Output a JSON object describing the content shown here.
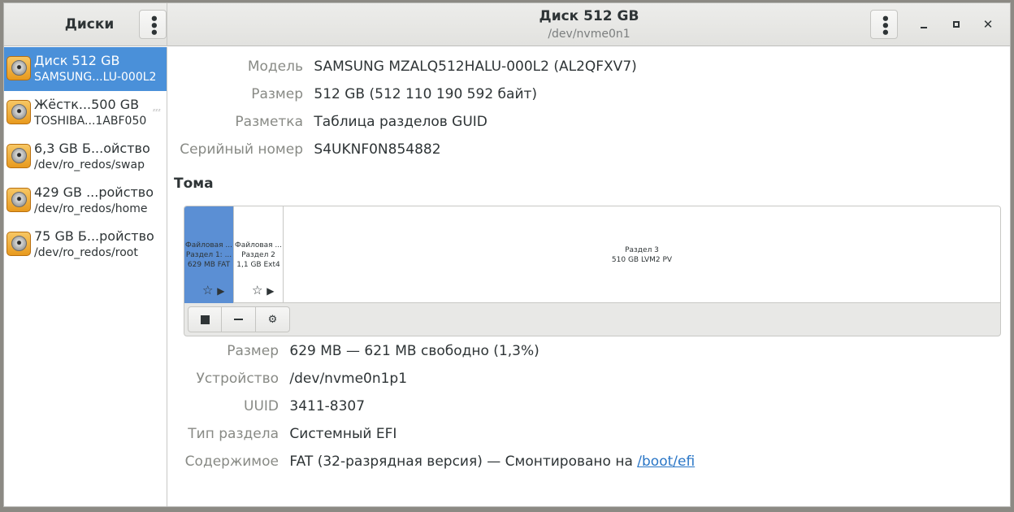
{
  "app": {
    "title": "Диски"
  },
  "header": {
    "title": "Диск 512 GB",
    "subtitle": "/dev/nvme0n1"
  },
  "sidebar": {
    "items": [
      {
        "name": "Диск 512 GB",
        "sub": "SAMSUNG...LU-000L2",
        "selected": true
      },
      {
        "name": "Жёстк...500 GB",
        "sub": "TOSHIBA...1ABF050",
        "sleeping": true
      },
      {
        "name": "6,3 GB Б...ойство",
        "sub": "/dev/ro_redos/swap"
      },
      {
        "name": "429 GB ...ройство",
        "sub": "/dev/ro_redos/home"
      },
      {
        "name": "75 GB Б...ройство",
        "sub": "/dev/ro_redos/root"
      }
    ]
  },
  "disk": {
    "model_label": "Модель",
    "model": "SAMSUNG MZALQ512HALU-000L2 (AL2QFXV7)",
    "size_label": "Размер",
    "size": "512 GB (512 110 190 592 байт)",
    "partitioning_label": "Разметка",
    "partitioning": "Таблица разделов GUID",
    "serial_label": "Серийный номер",
    "serial": "S4UKNF0N854882"
  },
  "volumes": {
    "heading": "Тома",
    "segments": [
      {
        "l1": "Файловая ...",
        "l2": "Раздел 1: ...",
        "l3": "629 MB FAT"
      },
      {
        "l1": "Файловая ...",
        "l2": "Раздел 2",
        "l3": "1,1 GB Ext4"
      },
      {
        "l1": "Раздел 3",
        "l2": "510 GB LVM2 PV"
      }
    ]
  },
  "partition": {
    "size_label": "Размер",
    "size": "629 MB — 621 MB свободно (1,3%)",
    "device_label": "Устройство",
    "device": "/dev/nvme0n1p1",
    "uuid_label": "UUID",
    "uuid": "3411-8307",
    "type_label": "Тип раздела",
    "type": "Системный EFI",
    "contents_label": "Содержимое",
    "contents_prefix": "FAT (32-разрядная версия) — Смонтировано на ",
    "contents_link": "/boot/efi"
  },
  "colors": {
    "selection": "#4a90d9",
    "link": "#2a76c6"
  }
}
